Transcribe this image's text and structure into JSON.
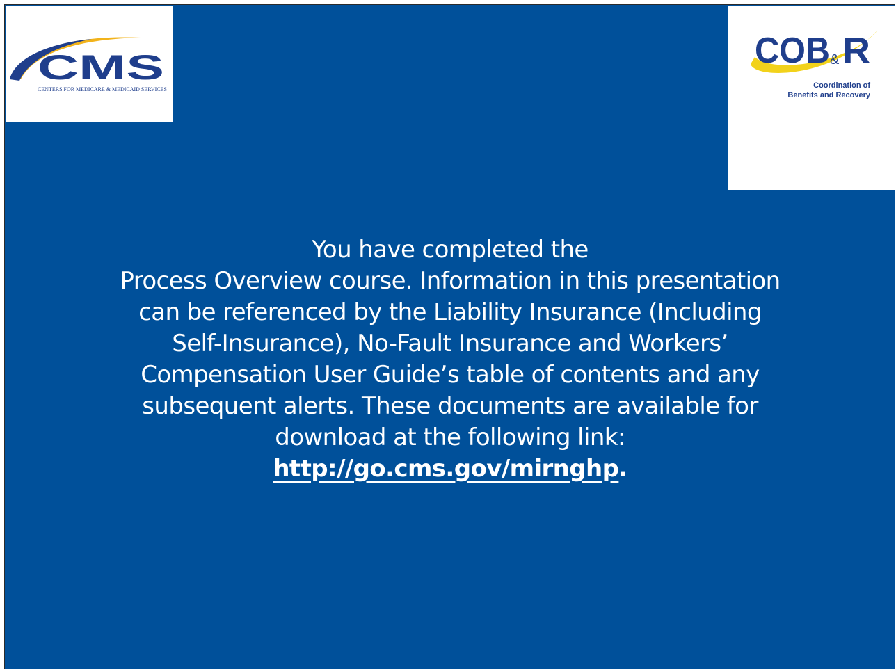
{
  "logos": {
    "cms": {
      "wordmark": "CMS",
      "tagline": "CENTERS FOR MEDICARE & MEDICAID SERVICES",
      "colors": {
        "wordmark": "#1F3E8C",
        "swoosh": "#F2B31B",
        "swoosh_blue": "#1F3E8C"
      }
    },
    "cobr": {
      "wordmark_cob": "COB",
      "wordmark_amp": "&",
      "wordmark_r": "R",
      "tagline_line1": "Coordination of",
      "tagline_line2": "Benefits and Recovery",
      "colors": {
        "wordmark": "#1F3E8C",
        "swoosh": "#F2D21B"
      }
    }
  },
  "message": {
    "lines": [
      "You have completed the",
      "Process Overview course. Information in this presentation",
      "can be referenced by the Liability Insurance (Including",
      "Self-Insurance), No-Fault Insurance and Workers’",
      "Compensation User Guide’s table of contents and any",
      "subsequent alerts. These documents are available for",
      "download at the following link:"
    ],
    "link_text": "http://go.cms.gov/mirnghp",
    "link_suffix": "."
  },
  "colors": {
    "slide_background": "#00509A",
    "text": "#FFFFFF"
  }
}
